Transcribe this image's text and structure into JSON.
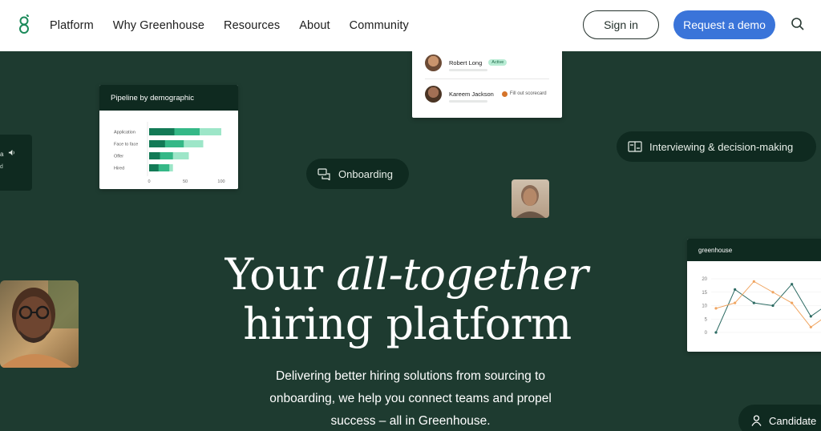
{
  "nav": {
    "logo_icon": "greenhouse-g-logo",
    "links": [
      "Platform",
      "Why Greenhouse",
      "Resources",
      "About",
      "Community"
    ],
    "signin_label": "Sign in",
    "demo_label": "Request a demo",
    "search_icon": "search-icon",
    "colors": {
      "demo_button": "#3a74d9",
      "background": "#ffffff"
    }
  },
  "hero": {
    "background": "#1e3b30",
    "headline_line1_plain": "Your",
    "headline_line1_italic": "all-together",
    "headline_line2": "hiring platform",
    "subtext": [
      "Delivering better hiring solutions from sourcing to",
      "onboarding, we help you connect teams and propel",
      "success – all in Greenhouse."
    ],
    "pills": {
      "onboarding": "Onboarding",
      "interviewing": "Interviewing & decision-making",
      "candidate": "Candidate"
    },
    "left_card": {
      "line1": "a",
      "line2": "ed"
    },
    "people_card": {
      "person1_name": "Robert Long",
      "person1_badge": "Active",
      "person2_name": "Kareem Jackson",
      "person2_note": "Fill out scorecard"
    }
  },
  "chart_data": [
    {
      "type": "bar",
      "title": "Pipeline by demographic",
      "categories": [
        "Application",
        "Face to face",
        "Offer",
        "Hired"
      ],
      "series": [
        {
          "values": [
            35,
            22,
            15,
            13
          ]
        },
        {
          "values": [
            70,
            48,
            33,
            28
          ]
        },
        {
          "values": [
            100,
            75,
            55,
            33
          ]
        }
      ],
      "xticks": [
        "0",
        "50",
        "100"
      ],
      "xlim": [
        0,
        100
      ],
      "colors": [
        "#137a56",
        "#35b887",
        "#9de6c8"
      ]
    },
    {
      "type": "line",
      "title": "greenhouse",
      "x": [
        1,
        2,
        3,
        4,
        5,
        6,
        7
      ],
      "series": [
        {
          "values": [
            0,
            16,
            11,
            10,
            18,
            6,
            11
          ],
          "color": "#2d6b63"
        },
        {
          "values": [
            9,
            11,
            19,
            15,
            11,
            2,
            7
          ],
          "color": "#f0a561"
        }
      ],
      "yticks": [
        "20",
        "15",
        "10",
        "5",
        "0"
      ],
      "ylim": [
        0,
        20
      ]
    }
  ]
}
